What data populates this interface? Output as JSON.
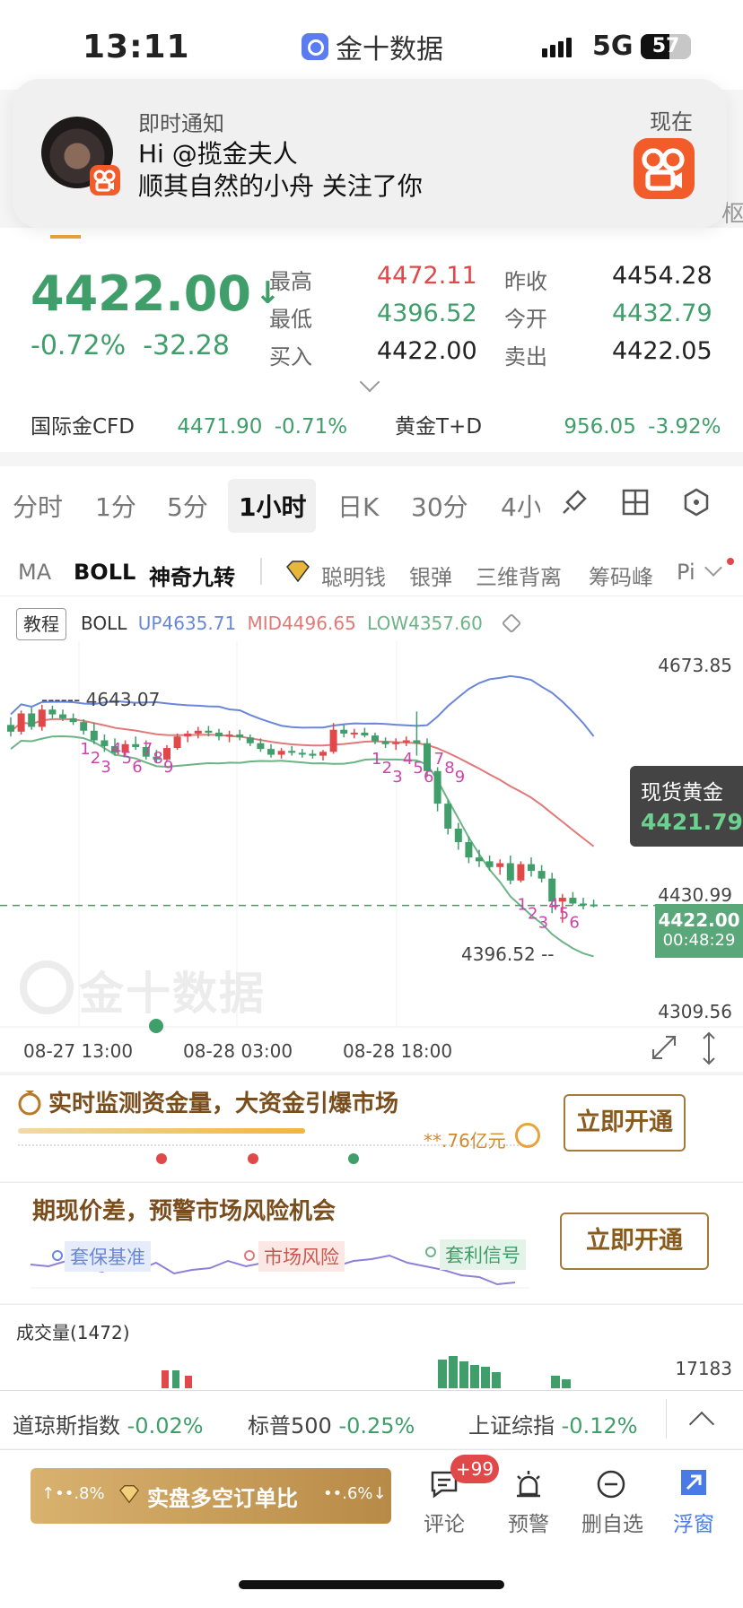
{
  "status_bar": {
    "time": "13:11",
    "app_name": "金十数据",
    "network": "5G",
    "battery": "57"
  },
  "notification": {
    "title": "即时通知",
    "line1": "Hi @揽金夫人",
    "line2": "顺其自然的小舟 关注了你",
    "time": "现在"
  },
  "quote": {
    "price": "4422.00",
    "direction_arrow": "↓",
    "change_pct": "-0.72%",
    "change": "-32.28",
    "high_label": "最高",
    "high": "4472.11",
    "low_label": "最低",
    "low": "4396.52",
    "bid_label": "买入",
    "bid": "4422.00",
    "prev_close_label": "昨收",
    "prev_close": "4454.28",
    "open_label": "今开",
    "open": "4432.79",
    "ask_label": "卖出",
    "ask": "4422.05",
    "related": [
      {
        "name": "国际金CFD",
        "price": "4471.90",
        "pct": "-0.71%"
      },
      {
        "name": "黄金T+D",
        "price": "956.05",
        "pct": "-3.92%"
      }
    ]
  },
  "tabs": [
    "分时",
    "1分",
    "5分",
    "1小时",
    "日K",
    "30分",
    "4小"
  ],
  "active_tab": "1小时",
  "indicators": [
    "MA",
    "BOLL",
    "神奇九转",
    "聪明钱",
    "银弹",
    "三维背离",
    "筹码峰",
    "Pi"
  ],
  "chart_data": {
    "type": "candlestick",
    "tutorial_label": "教程",
    "boll": {
      "label": "BOLL",
      "up": "UP4635.71",
      "mid": "MID4496.65",
      "low": "LOW4357.60"
    },
    "y_ticks": [
      "4673.85",
      "4430.99",
      "4309.56"
    ],
    "marker_high": "4643.07",
    "marker_low": "4396.52",
    "current_price": "4422.00",
    "countdown": "00:48:29",
    "spot_label": "现货黄金",
    "spot_price": "4421.79",
    "x_ticks": [
      "08-27 13:00",
      "08-28 03:00",
      "08-28 18:00"
    ],
    "ylim": [
      4309.56,
      4673.85
    ],
    "watermark": "金十数据",
    "candles": [
      [
        4610,
        4618,
        4598,
        4603
      ],
      [
        4603,
        4625,
        4600,
        4622
      ],
      [
        4622,
        4628,
        4605,
        4608
      ],
      [
        4608,
        4631,
        4604,
        4626
      ],
      [
        4626,
        4630,
        4617,
        4621
      ],
      [
        4621,
        4626,
        4614,
        4617
      ],
      [
        4617,
        4622,
        4610,
        4613
      ],
      [
        4613,
        4616,
        4600,
        4604
      ],
      [
        4604,
        4612,
        4590,
        4594
      ],
      [
        4594,
        4600,
        4582,
        4588
      ],
      [
        4588,
        4596,
        4578,
        4581
      ],
      [
        4581,
        4594,
        4578,
        4590
      ],
      [
        4590,
        4598,
        4584,
        4587
      ],
      [
        4587,
        4594,
        4574,
        4577
      ],
      [
        4577,
        4584,
        4570,
        4574
      ],
      [
        4574,
        4589,
        4572,
        4586
      ],
      [
        4586,
        4601,
        4584,
        4598
      ],
      [
        4598,
        4604,
        4592,
        4601
      ],
      [
        4601,
        4608,
        4596,
        4604
      ],
      [
        4604,
        4609,
        4598,
        4602
      ],
      [
        4602,
        4606,
        4594,
        4598
      ],
      [
        4598,
        4604,
        4592,
        4600
      ],
      [
        4600,
        4605,
        4594,
        4597
      ],
      [
        4597,
        4600,
        4588,
        4591
      ],
      [
        4591,
        4596,
        4582,
        4585
      ],
      [
        4585,
        4590,
        4576,
        4579
      ],
      [
        4579,
        4586,
        4575,
        4583
      ],
      [
        4583,
        4588,
        4578,
        4581
      ],
      [
        4581,
        4585,
        4576,
        4580
      ],
      [
        4580,
        4584,
        4575,
        4578
      ],
      [
        4578,
        4584,
        4573,
        4582
      ],
      [
        4582,
        4612,
        4580,
        4605
      ],
      [
        4605,
        4610,
        4597,
        4601
      ],
      [
        4601,
        4606,
        4596,
        4602
      ],
      [
        4602,
        4607,
        4597,
        4599
      ],
      [
        4599,
        4602,
        4590,
        4593
      ],
      [
        4593,
        4597,
        4586,
        4590
      ],
      [
        4590,
        4596,
        4584,
        4592
      ],
      [
        4592,
        4598,
        4588,
        4594
      ],
      [
        4594,
        4624,
        4578,
        4591
      ],
      [
        4591,
        4596,
        4556,
        4562
      ],
      [
        4562,
        4566,
        4520,
        4528
      ],
      [
        4528,
        4532,
        4496,
        4502
      ],
      [
        4502,
        4508,
        4480,
        4488
      ],
      [
        4488,
        4494,
        4466,
        4472
      ],
      [
        4472,
        4480,
        4462,
        4468
      ],
      [
        4468,
        4474,
        4458,
        4462
      ],
      [
        4462,
        4470,
        4454,
        4466
      ],
      [
        4466,
        4474,
        4444,
        4448
      ],
      [
        4448,
        4468,
        4446,
        4465
      ],
      [
        4465,
        4472,
        4452,
        4458
      ],
      [
        4458,
        4464,
        4446,
        4450
      ],
      [
        4450,
        4456,
        4414,
        4426
      ],
      [
        4426,
        4434,
        4404,
        4430
      ],
      [
        4430,
        4436,
        4422,
        4424
      ],
      [
        4424,
        4430,
        4418,
        4423
      ],
      [
        4423,
        4428,
        4420,
        4422
      ]
    ],
    "nine_labels_1": [
      "1",
      "2",
      "3",
      "4",
      "5",
      "6",
      "7",
      "8",
      "9"
    ],
    "nine_labels_2": [
      "1",
      "2",
      "3",
      "4",
      "5",
      "6",
      "7",
      "8",
      "9"
    ],
    "nine_labels_3": [
      "1",
      "2",
      "3",
      "4",
      "5",
      "6"
    ]
  },
  "promo1": {
    "title": "实时监测资金量，大资金引爆市场",
    "amount": "**.76亿元",
    "button": "立即开通"
  },
  "promo2": {
    "title": "期现价差，预警市场风险机会",
    "tags": [
      "套保基准",
      "市场风险",
      "套利信号"
    ],
    "button": "立即开通"
  },
  "volume": {
    "label": "成交量(1472)",
    "max": "17183"
  },
  "indices": [
    {
      "name": "道琼斯指数",
      "pct": "-0.02%"
    },
    {
      "name": "标普500",
      "pct": "-0.25%"
    },
    {
      "name": "上证综指",
      "pct": "-0.12%"
    }
  ],
  "bottom_bar": {
    "banner_left": "••.8%",
    "banner_text": "实盘多空订单比",
    "banner_right": "••.6%",
    "comment_badge": "+99",
    "nav": [
      "评论",
      "预警",
      "删自选",
      "浮窗"
    ]
  }
}
